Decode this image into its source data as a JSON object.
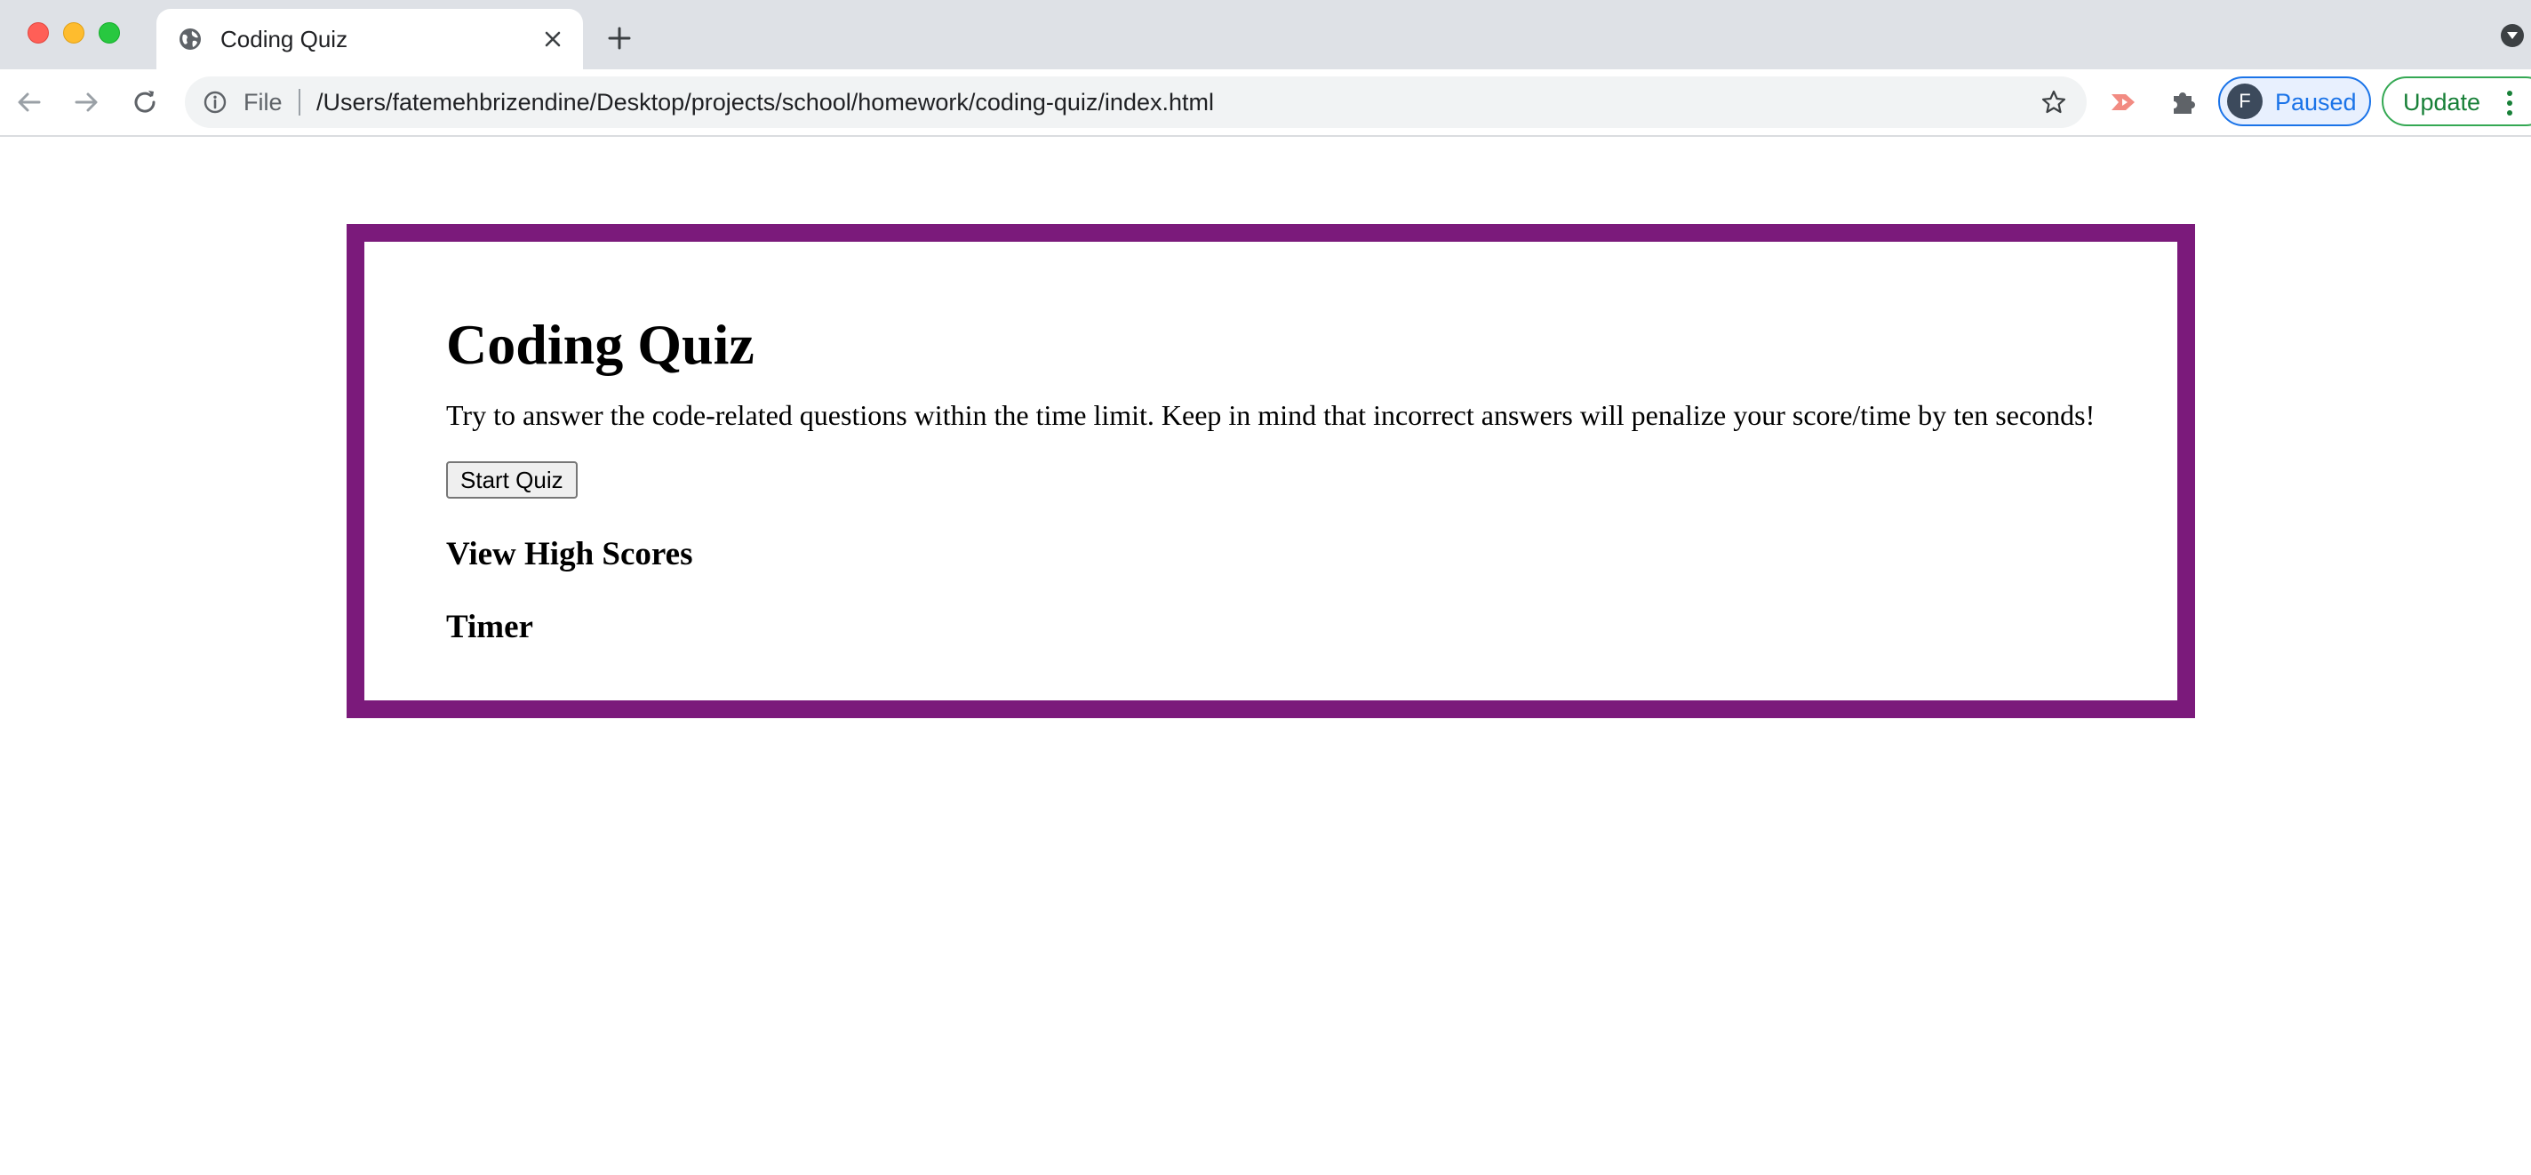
{
  "browser": {
    "tab": {
      "title": "Coding Quiz"
    },
    "address_bar": {
      "scheme_label": "File",
      "url": "/Users/fatemehbrizendine/Desktop/projects/school/homework/coding-quiz/index.html"
    },
    "profile": {
      "initial": "F",
      "status": "Paused"
    },
    "update_label": "Update",
    "icons": [
      "back-arrow-icon",
      "forward-arrow-icon",
      "reload-icon",
      "info-icon",
      "star-icon",
      "extension-icon",
      "puzzle-icon",
      "kebab-menu-icon",
      "globe-icon",
      "close-icon",
      "plus-icon",
      "chevron-down-icon"
    ],
    "colors": {
      "tabstrip": "#dee1e6",
      "omnibox": "#f1f3f4",
      "profile_accent": "#1a73e8",
      "update_accent": "#188038"
    }
  },
  "page": {
    "title": "Coding Quiz",
    "intro": "Try to answer the code-related questions within the time limit. Keep in mind that incorrect answers will penalize your score/time by ten seconds!",
    "start_button_label": "Start Quiz",
    "high_scores_label": "View High Scores",
    "timer_label": "Timer",
    "colors": {
      "card_border": "#7b1a7b"
    }
  }
}
